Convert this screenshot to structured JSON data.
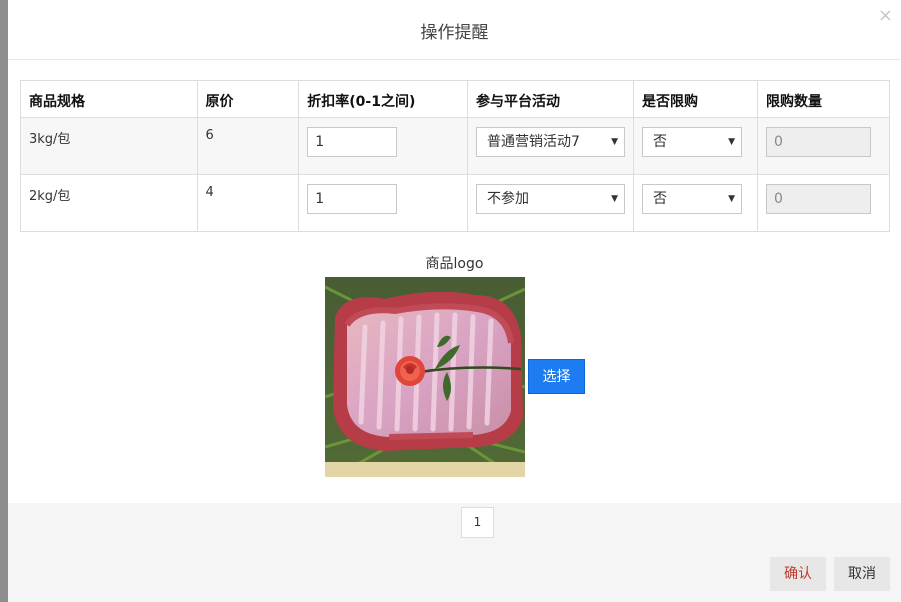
{
  "dialog": {
    "title": "操作提醒",
    "close_symbol": "×"
  },
  "table": {
    "headers": [
      "商品规格",
      "原价",
      "折扣率(0-1之间)",
      "参与平台活动",
      "是否限购",
      "限购数量"
    ],
    "rows": [
      {
        "spec": "3kg/包",
        "price": "6",
        "discount": "1",
        "activity": "普通营销活动7",
        "limit": "否",
        "limit_qty": "0"
      },
      {
        "spec": "2kg/包",
        "price": "4",
        "discount": "1",
        "activity": "不参加",
        "limit": "否",
        "limit_qty": "0"
      }
    ]
  },
  "logo": {
    "label": "商品logo",
    "choose_label": "选择"
  },
  "pager": {
    "current": "1"
  },
  "footer": {
    "ok_label": "确认",
    "cancel_label": "取消"
  },
  "colors": {
    "primary": "#1e7cf2",
    "ok_text": "#c0392b"
  }
}
